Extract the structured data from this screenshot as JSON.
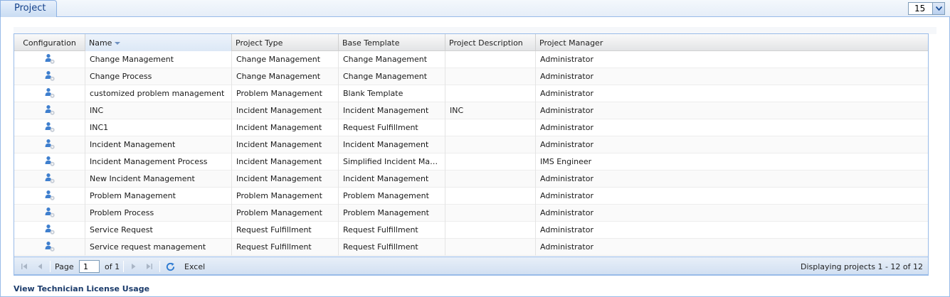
{
  "panel": {
    "tab_label": "Project",
    "page_size": "15"
  },
  "grid": {
    "columns": {
      "configuration": "Configuration",
      "name": "Name",
      "project_type": "Project Type",
      "base_template": "Base Template",
      "project_description": "Project Description",
      "project_manager": "Project Manager"
    },
    "rows": [
      {
        "name": "Change Management",
        "type": "Change Management",
        "template": "Change Management",
        "description": "",
        "manager": "Administrator"
      },
      {
        "name": "Change Process",
        "type": "Change Management",
        "template": "Change Management",
        "description": "",
        "manager": "Administrator"
      },
      {
        "name": "customized problem management",
        "type": "Problem Management",
        "template": "Blank Template",
        "description": "",
        "manager": "Administrator"
      },
      {
        "name": "INC",
        "type": "Incident Management",
        "template": "Incident Management",
        "description": "INC",
        "manager": "Administrator"
      },
      {
        "name": "INC1",
        "type": "Incident Management",
        "template": "Request Fulfillment",
        "description": "",
        "manager": "Administrator"
      },
      {
        "name": "Incident Management",
        "type": "Incident Management",
        "template": "Incident Management",
        "description": "",
        "manager": "Administrator"
      },
      {
        "name": "Incident Management Process",
        "type": "Incident Management",
        "template": "Simplified Incident Manage...",
        "description": "",
        "manager": "IMS Engineer"
      },
      {
        "name": "New Incident Management",
        "type": "Incident Management",
        "template": "Incident Management",
        "description": "",
        "manager": "Administrator"
      },
      {
        "name": "Problem Management",
        "type": "Problem Management",
        "template": "Problem Management",
        "description": "",
        "manager": "Administrator"
      },
      {
        "name": "Problem Process",
        "type": "Problem Management",
        "template": "Problem Management",
        "description": "",
        "manager": "Administrator"
      },
      {
        "name": "Service Request",
        "type": "Request Fulfillment",
        "template": "Request Fulfillment",
        "description": "",
        "manager": "Administrator"
      },
      {
        "name": "Service request management",
        "type": "Request Fulfillment",
        "template": "Request Fulfillment",
        "description": "",
        "manager": "Administrator"
      }
    ]
  },
  "paging": {
    "page_label": "Page",
    "current_page": "1",
    "of_label": "of 1",
    "excel_label": "Excel",
    "display_info": "Displaying projects 1 - 12 of 12"
  },
  "footer": {
    "license_link": "View Technician License Usage"
  },
  "colors": {
    "accent": "#15428b",
    "border": "#99bbe8",
    "link": "#1b3b6b"
  }
}
